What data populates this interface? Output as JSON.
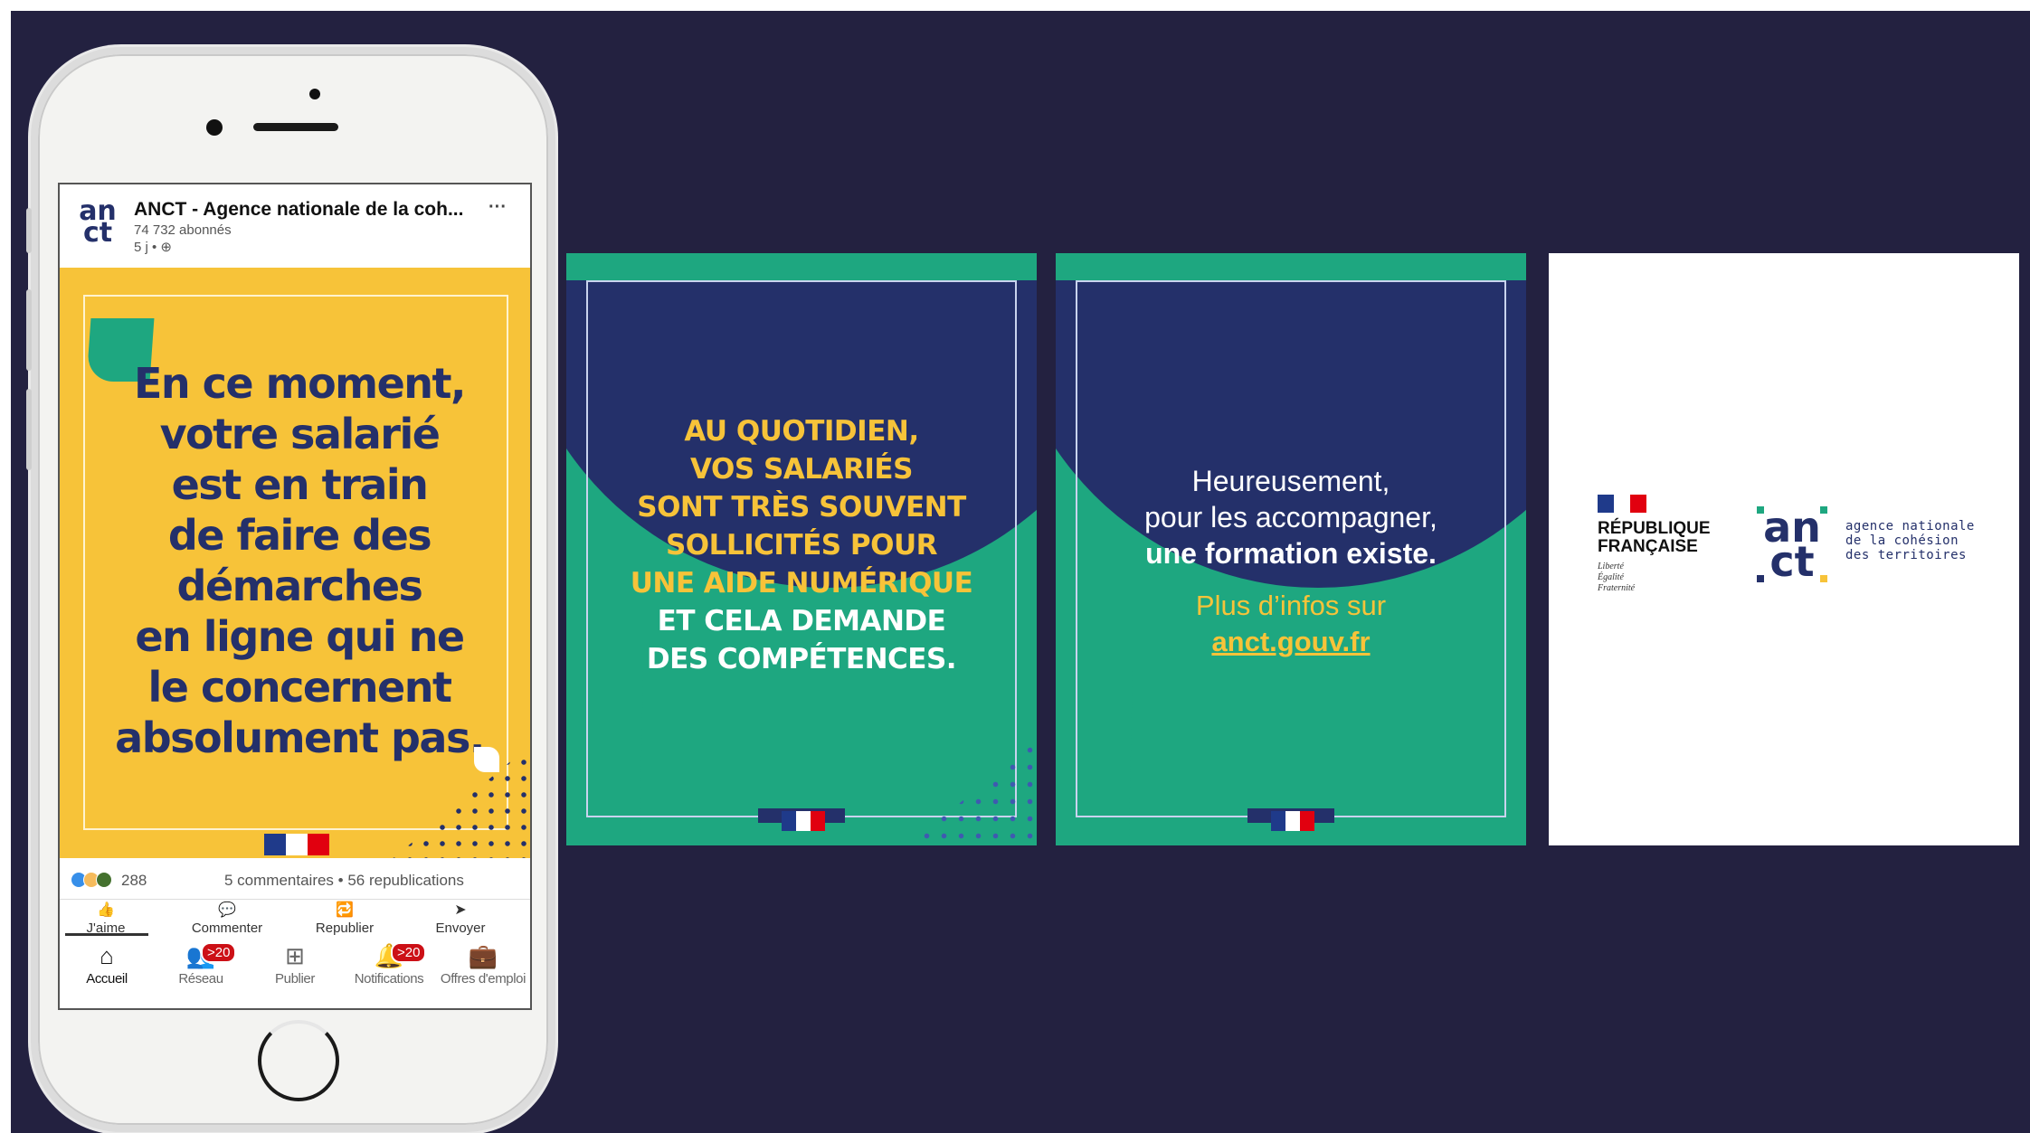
{
  "post": {
    "author": "ANCT - Agence nationale de la coh...",
    "avatar_line1": "an",
    "avatar_line2": "ct",
    "followers": "74 732 abonnés",
    "time": "5 j • ⊕",
    "more": "···",
    "quote": [
      "En ce moment,",
      "votre salarié",
      "est en train",
      "de faire des",
      "démarches",
      "en ligne qui ne",
      "le concernent",
      "absolument pas."
    ],
    "reactions_count": "288",
    "comments_reposts": "5 commentaires  •  56 republications",
    "actions": [
      {
        "label": "J'aime",
        "icon": "👍"
      },
      {
        "label": "Commenter",
        "icon": "💬"
      },
      {
        "label": "Republier",
        "icon": "🔁"
      },
      {
        "label": "Envoyer",
        "icon": "➤"
      }
    ]
  },
  "nav": [
    {
      "label": "Accueil",
      "icon": "⌂"
    },
    {
      "label": "Réseau",
      "icon": "👥",
      "badge": ">20"
    },
    {
      "label": "Publier",
      "icon": "⊞"
    },
    {
      "label": "Notifications",
      "icon": "🔔",
      "badge": ">20"
    },
    {
      "label": "Offres d'emploi",
      "icon": "💼"
    }
  ],
  "slide2": {
    "yellow_lines": [
      "AU QUOTIDIEN,",
      "VOS SALARIÉS",
      "SONT TRÈS SOUVENT",
      "SOLLICITÉS POUR",
      "UNE AIDE NUMÉRIQUE"
    ],
    "white_lines": [
      "ET CELA DEMANDE",
      "DES COMPÉTENCES."
    ]
  },
  "slide3": {
    "lines": [
      "Heureusement,",
      "pour les accompagner,"
    ],
    "bold_line": "une formation existe.",
    "more": "Plus d’infos sur",
    "link": "anct.gouv.fr"
  },
  "slide4": {
    "rf_name_line1": "RÉPUBLIQUE",
    "rf_name_line2": "FRANÇAISE",
    "rf_motto": [
      "Liberté",
      "Égalité",
      "Fraternité"
    ],
    "logo_line1": "an",
    "logo_line2": "ct",
    "tagline": [
      "agence nationale",
      "de la cohésion",
      "des territoires"
    ]
  },
  "colors": {
    "background": "#232140",
    "navy": "#24306a",
    "green": "#1ea780",
    "yellow": "#f7c339"
  }
}
